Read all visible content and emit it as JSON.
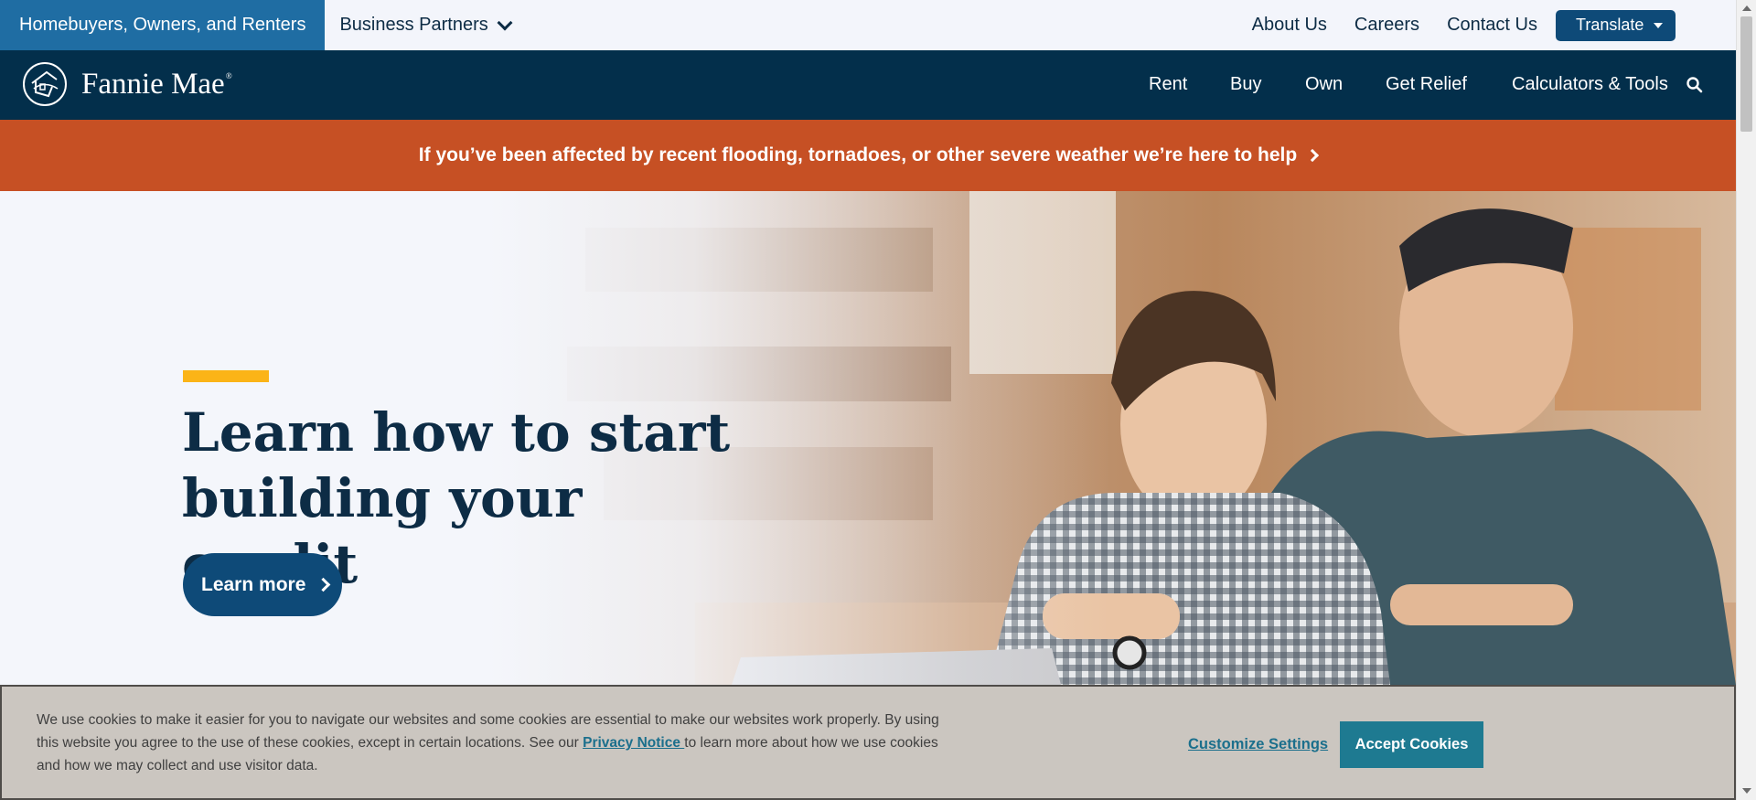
{
  "utility": {
    "audience_active": "Homebuyers, Owners, and Renters",
    "audience_other": "Business Partners",
    "links": [
      "About Us",
      "Careers",
      "Contact Us"
    ],
    "translate_label": "Translate"
  },
  "nav": {
    "brand": "Fannie Mae",
    "items": [
      "Rent",
      "Buy",
      "Own",
      "Get Relief",
      "Calculators & Tools"
    ]
  },
  "alert": {
    "text": "If you’ve been affected by recent flooding, tornadoes, or other severe weather we’re here to help"
  },
  "hero": {
    "title": "Learn how to start building your credit",
    "cta_label": "Learn more"
  },
  "cookie": {
    "text_before": "We use cookies to make it easier for you to navigate our websites and some cookies are essential to make our websites work properly. By using this website you agree to the use of these cookies, except in certain locations. See our ",
    "privacy_link": "Privacy Notice ",
    "text_after": "to learn more about how we use cookies and how we may collect and use visitor data.",
    "customize_label": "Customize Settings",
    "accept_label": "Accept Cookies"
  },
  "colors": {
    "navy": "#032f4b",
    "audience_blue": "#1f6da3",
    "button_blue": "#0e4a78",
    "alert_orange": "#c65024",
    "accent_yellow": "#fbb417",
    "cookie_teal": "#1e7a91"
  },
  "icons": {
    "brand": "house-circle-logo-icon",
    "search": "search-icon",
    "dropdown": "chevron-down-icon",
    "arrow": "chevron-right-icon"
  }
}
